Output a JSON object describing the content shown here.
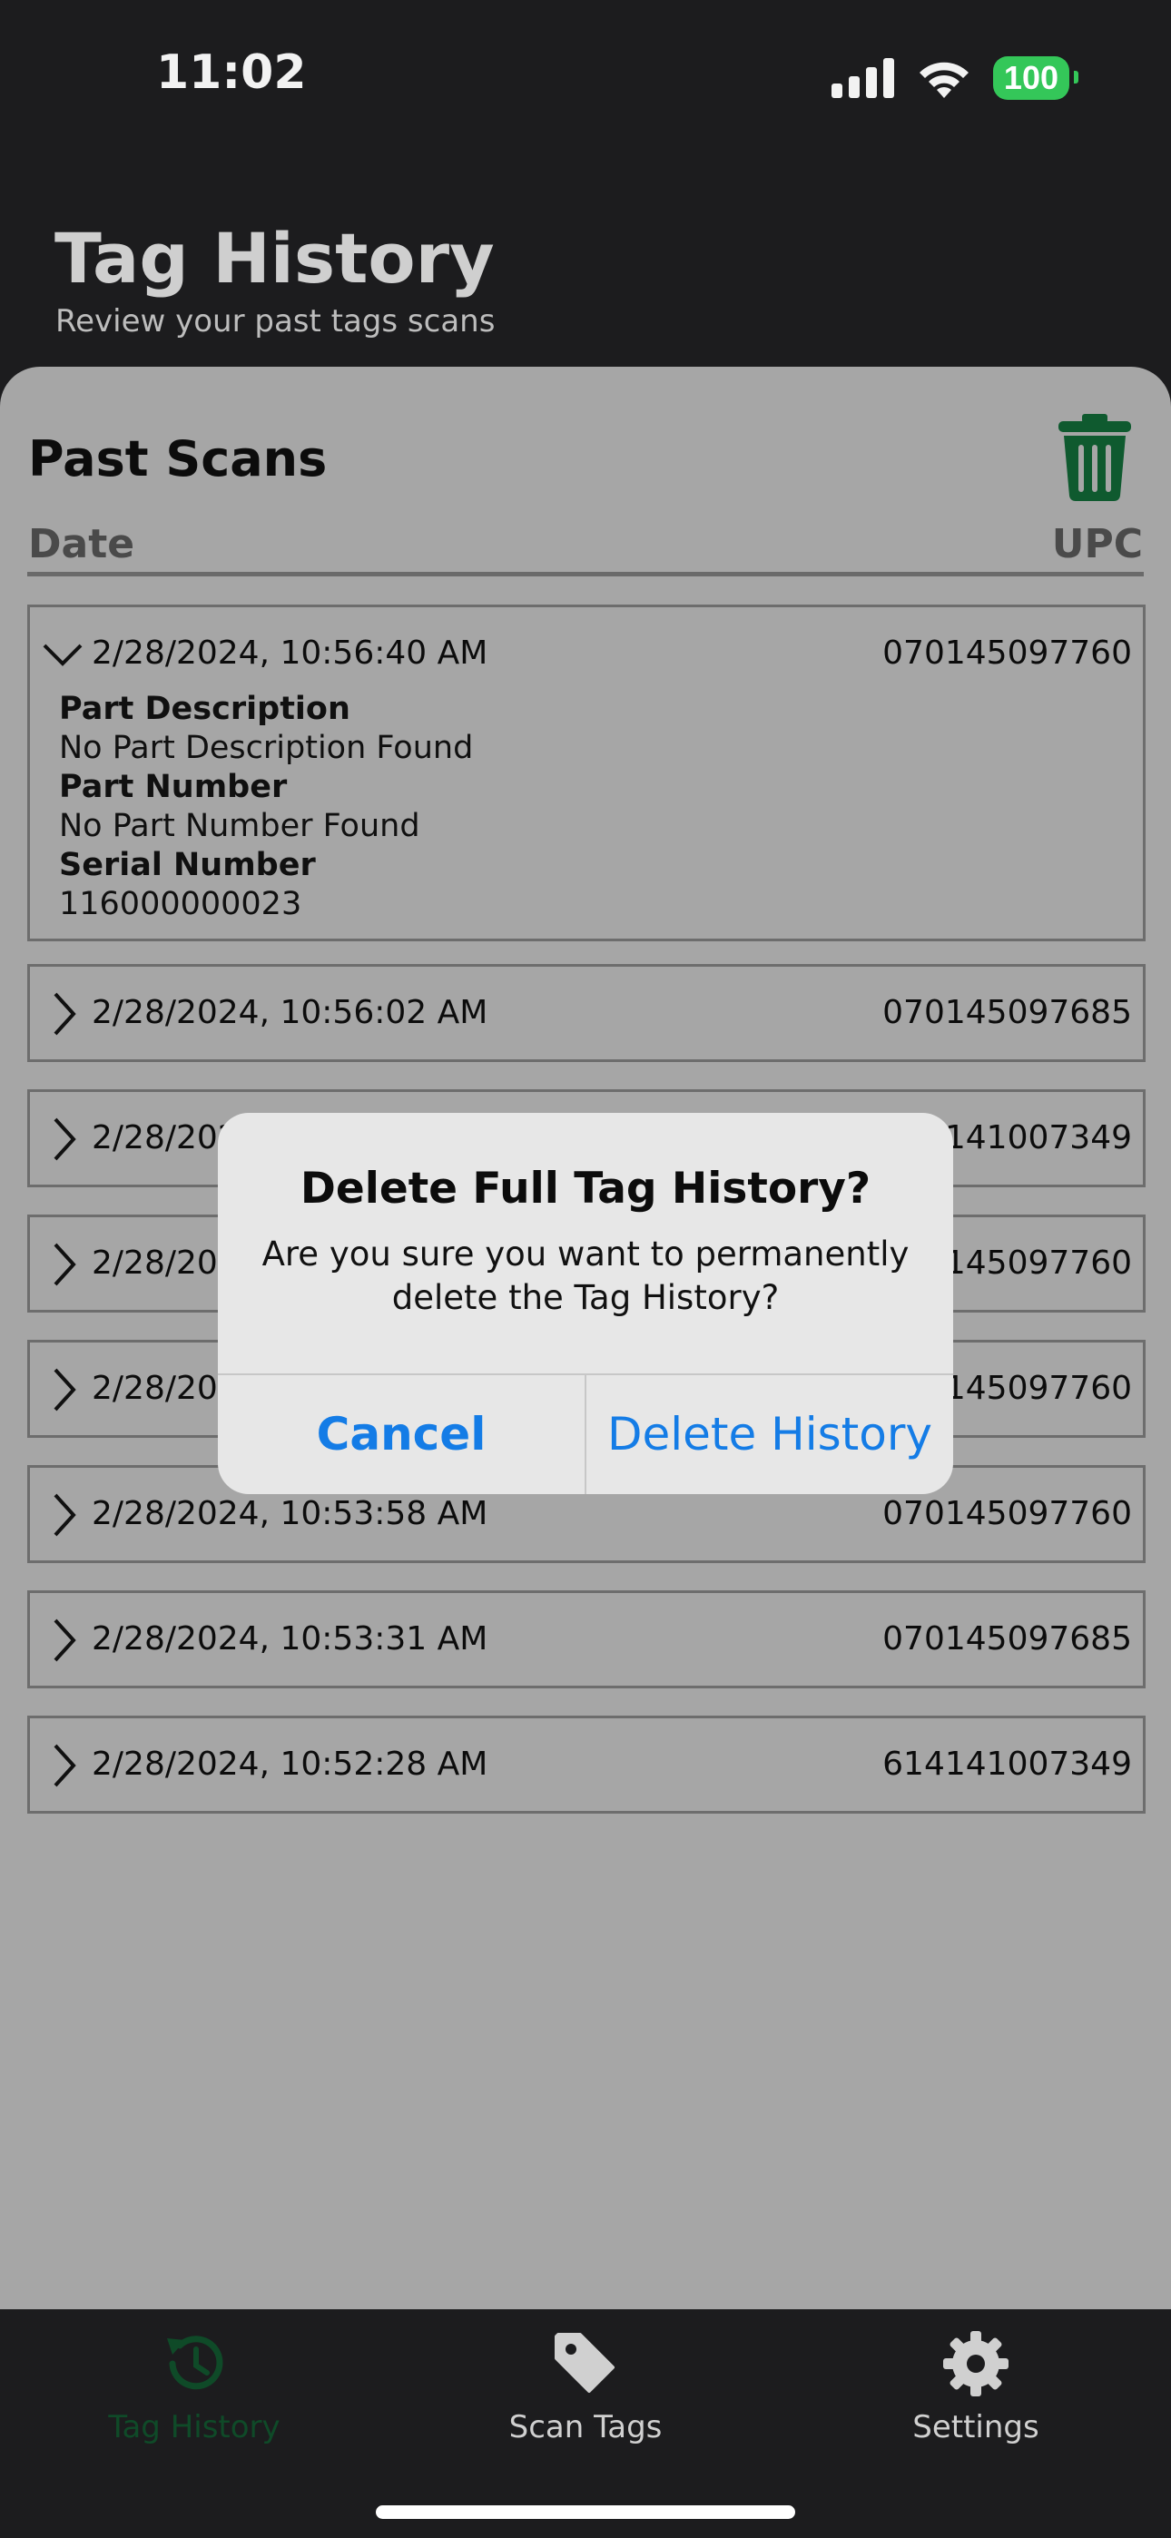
{
  "status": {
    "time": "11:02",
    "battery": "100",
    "accent": "#34c759"
  },
  "header": {
    "title": "Tag History",
    "subtitle": "Review your past tags scans"
  },
  "content": {
    "section_title": "Past Scans",
    "columns": {
      "date": "Date",
      "upc": "UPC"
    },
    "rows": [
      {
        "date": "2/28/2024, 10:56:40 AM",
        "upc": "070145097760",
        "expanded": true,
        "details": {
          "part_description_label": "Part Description",
          "part_description_value": "No Part Description Found",
          "part_number_label": "Part Number",
          "part_number_value": "No Part Number Found",
          "serial_number_label": "Serial Number",
          "serial_number_value": "116000000023"
        }
      },
      {
        "date": "2/28/2024, 10:56:02 AM",
        "upc": "070145097685"
      },
      {
        "date": "2/28/202",
        "upc": "141007349"
      },
      {
        "date": "2/28/202",
        "upc": "145097760"
      },
      {
        "date": "2/28/202",
        "upc": "145097760"
      },
      {
        "date": "2/28/2024, 10:53:58 AM",
        "upc": "070145097760"
      },
      {
        "date": "2/28/2024, 10:53:31 AM",
        "upc": "070145097685"
      },
      {
        "date": "2/28/2024, 10:52:28 AM",
        "upc": "614141007349"
      }
    ],
    "trash_icon": "trash-icon",
    "trash_color": "#0f5a2f"
  },
  "dialog": {
    "title": "Delete Full Tag History?",
    "message": "Are you sure you want to permanently delete the Tag History?",
    "cancel_label": "Cancel",
    "confirm_label": "Delete History",
    "button_color": "#147ce6"
  },
  "tabbar": {
    "tabs": [
      {
        "label": "Tag History",
        "icon": "history-icon",
        "active": true
      },
      {
        "label": "Scan Tags",
        "icon": "tag-icon",
        "active": false
      },
      {
        "label": "Settings",
        "icon": "gear-icon",
        "active": false
      }
    ],
    "active_color": "#0f4a28",
    "inactive_color": "#d0d0d0"
  }
}
